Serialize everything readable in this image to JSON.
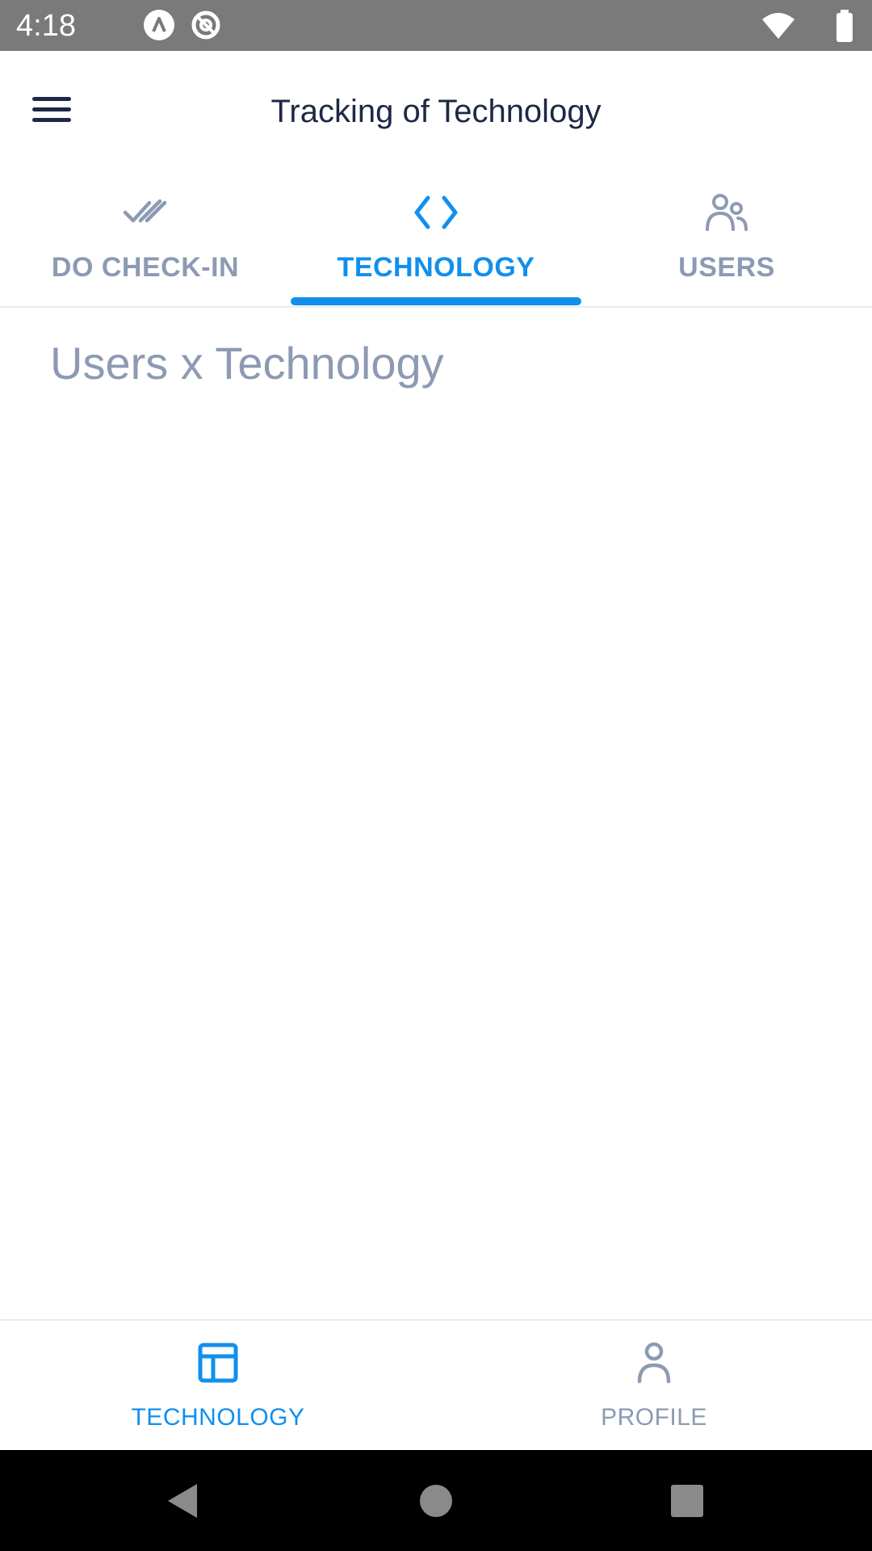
{
  "status_bar": {
    "time": "4:18",
    "icons": [
      "a-notification-icon",
      "at-notification-icon",
      "wifi-icon",
      "battery-icon"
    ]
  },
  "app_bar": {
    "title": "Tracking of Technology",
    "menu_icon": "menu-icon"
  },
  "tabs": [
    {
      "label": "DO CHECK-IN",
      "icon": "double-check-icon",
      "active": false
    },
    {
      "label": "TECHNOLOGY",
      "icon": "code-icon",
      "active": true
    },
    {
      "label": "USERS",
      "icon": "users-icon",
      "active": false
    }
  ],
  "content": {
    "title": "Users x Technology"
  },
  "bottom_nav": [
    {
      "label": "TECHNOLOGY",
      "icon": "layout-icon",
      "active": true
    },
    {
      "label": "PROFILE",
      "icon": "person-icon",
      "active": false
    }
  ],
  "system_nav": {
    "icons": [
      "back-icon",
      "home-icon",
      "recents-icon"
    ]
  },
  "colors": {
    "accent": "#1090ec",
    "inactive": "#8c9ab3",
    "title": "#1e2846",
    "status_bar": "#7a7a7a"
  }
}
